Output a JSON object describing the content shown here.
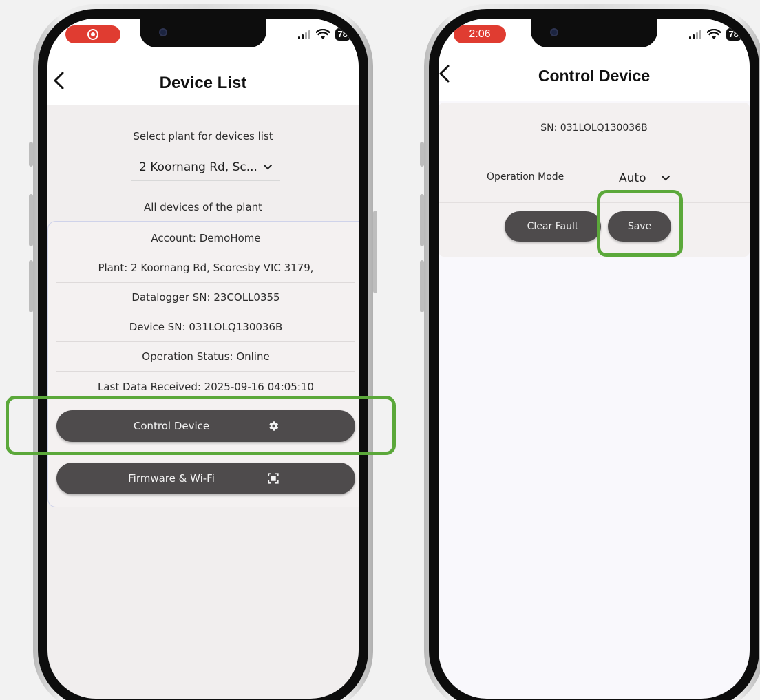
{
  "left_phone": {
    "title": "Device List",
    "select_prompt": "Select plant for devices list",
    "plant_dropdown_value": "2 Koornang Rd, Sc...",
    "all_devices_label": "All devices of the plant",
    "device_info": [
      "Account: DemoHome",
      "Plant: 2 Koornang Rd, Scoresby VIC 3179,",
      "Datalogger SN: 23COLL0355",
      "Device SN: 031LOLQ130036B",
      "Operation Status: Online",
      "Last Data Received: 2025-09-16 04:05:10"
    ],
    "control_device_label": "Control Device",
    "firmware_label": "Firmware & Wi-Fi",
    "battery": "78"
  },
  "right_phone": {
    "time": "2:06",
    "title": "Control Device",
    "sn_label": "SN: 031LOLQ130036B",
    "operation_mode_label": "Operation Mode",
    "operation_mode_value": "Auto",
    "clear_fault_label": "Clear Fault",
    "save_label": "Save",
    "battery": "78"
  },
  "colors": {
    "highlight": "#5ba83a",
    "button": "#4e4b4c",
    "recording_pill": "#e03c31"
  },
  "icons": [
    "back-chevron-icon",
    "chevron-down-icon",
    "gear-icon",
    "scan-icon",
    "wifi-icon",
    "signal-icon",
    "battery-icon",
    "record-icon"
  ]
}
